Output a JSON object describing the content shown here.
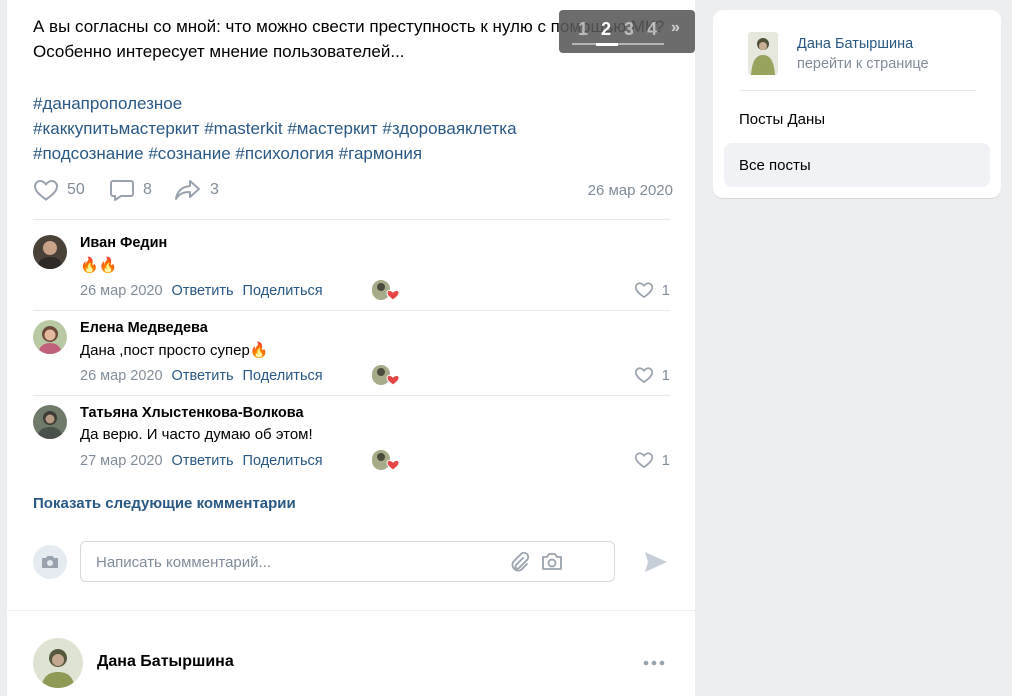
{
  "post": {
    "text": "А вы согласны со мной: что можно свести преступность к нулю с помощью МК? Особенно интересует мнение пользователей...",
    "hashtags_line1": "#данапрополезное",
    "hashtags_line2": "#каккупитьмастеркит #masterkit #мастеркит #здороваяклетка",
    "hashtags_line3": "#подсознание #сознание #психология #гармония",
    "likes": "50",
    "comments": "8",
    "shares": "3",
    "date": "26 мар 2020"
  },
  "photo_pager": {
    "pages": [
      "1",
      "2",
      "3",
      "4"
    ],
    "active": "2",
    "next": "»"
  },
  "comments": [
    {
      "author": "Иван Федин",
      "text": "",
      "emoji": "🔥🔥",
      "date": "26 мар 2020",
      "reply": "Ответить",
      "share": "Поделиться",
      "likes": "1"
    },
    {
      "author": "Елена Медведева",
      "text": "Дана ,пост просто супер",
      "emoji": "🔥",
      "date": "26 мар 2020",
      "reply": "Ответить",
      "share": "Поделиться",
      "likes": "1"
    },
    {
      "author": "Татьяна Хлыстенкова-Волкова",
      "text": "Да верю. И часто думаю об этом!",
      "emoji": "",
      "date": "27 мар 2020",
      "reply": "Ответить",
      "share": "Поделиться",
      "likes": "1"
    }
  ],
  "show_more": "Показать следующие комментарии",
  "composer": {
    "placeholder": "Написать комментарий..."
  },
  "next_post": {
    "author": "Дана Батыршина"
  },
  "sidebar": {
    "name": "Дана Батыршина",
    "sub": "перейти к странице",
    "items": [
      "Посты Даны",
      "Все посты"
    ]
  },
  "colors": {
    "link": "#2a5885",
    "muted": "#818c99",
    "heart": "#e64646",
    "background": "#edeef0"
  },
  "icons": [
    "heart-icon",
    "comment-icon",
    "share-icon",
    "paperclip-icon",
    "camera-icon",
    "send-icon",
    "more-icon",
    "fire-emoji"
  ]
}
